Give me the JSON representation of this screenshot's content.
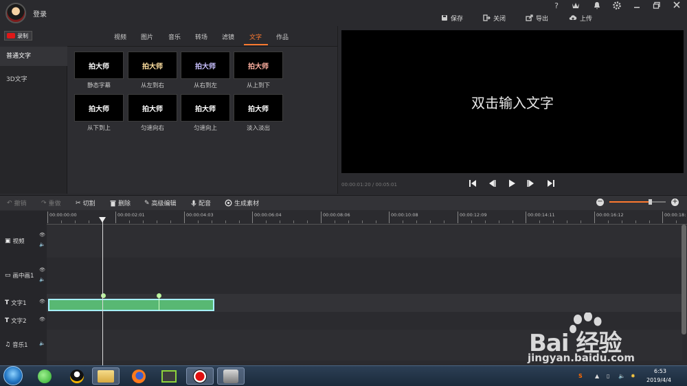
{
  "header": {
    "login_label": "登录",
    "icons": [
      "help-icon",
      "vip-icon",
      "notification-icon",
      "settings-icon",
      "minimize-icon",
      "restore-icon",
      "close-icon"
    ],
    "help_glyph": "?",
    "actions": [
      {
        "icon": "save-icon",
        "label": "保存"
      },
      {
        "icon": "close-project-icon",
        "label": "关闭"
      },
      {
        "icon": "export-icon",
        "label": "导出"
      },
      {
        "icon": "upload-icon",
        "label": "上传"
      }
    ]
  },
  "record_button": {
    "label": "录制"
  },
  "categories": [
    {
      "label": "普通文字",
      "active": true
    },
    {
      "label": "3D文字",
      "active": false
    }
  ],
  "tabs": [
    {
      "label": "视频",
      "active": false
    },
    {
      "label": "图片",
      "active": false
    },
    {
      "label": "音乐",
      "active": false
    },
    {
      "label": "转场",
      "active": false
    },
    {
      "label": "滤镜",
      "active": false
    },
    {
      "label": "文字",
      "active": true
    },
    {
      "label": "作品",
      "active": false
    }
  ],
  "text_templates": [
    {
      "preview": "拍大师",
      "label": "静态字幕",
      "color": "#ffffff"
    },
    {
      "preview": "拍大师",
      "label": "从左到右",
      "color": "#ffe0a0"
    },
    {
      "preview": "拍大师",
      "label": "从右到左",
      "color": "#c8c0ff"
    },
    {
      "preview": "拍大师",
      "label": "从上到下",
      "color": "#ffb0a0"
    },
    {
      "preview": "拍大师",
      "label": "从下到上",
      "color": "#ffffff"
    },
    {
      "preview": "拍大师",
      "label": "匀速向右",
      "color": "#ffffff"
    },
    {
      "preview": "拍大师",
      "label": "匀速向上",
      "color": "#ffffff"
    },
    {
      "preview": "拍大师",
      "label": "淡入淡出",
      "color": "#ffffff"
    }
  ],
  "preview": {
    "text": "双击输入文字",
    "timecode": "00:00:01:20 / 00:05:01"
  },
  "playback_icons": [
    "skip-to-start-icon",
    "previous-frame-icon",
    "play-icon",
    "next-frame-icon",
    "skip-to-end-icon"
  ],
  "toolbar": {
    "undo": "撤销",
    "redo": "重做",
    "cut": "切割",
    "delete": "删除",
    "advanced_edit": "高级编辑",
    "dub": "配音",
    "generate": "生成素材",
    "zoom_level": 0.72
  },
  "ruler_labels": [
    "00:00:00:00",
    "00:00:02:01",
    "00:00:04:03",
    "00:00:06:04",
    "00:00:08:06",
    "00:00:10:08",
    "00:00:12:09",
    "00:00:14:11",
    "00:00:16:12",
    "00:00:18:"
  ],
  "tracks": [
    {
      "label": "视频",
      "icon": "video-track-icon"
    },
    {
      "label": "画中画1",
      "icon": "pip-track-icon"
    },
    {
      "label": "文字1",
      "icon": "text-track-icon"
    },
    {
      "label": "文字2",
      "icon": "text-track-icon"
    },
    {
      "label": "音乐1",
      "icon": "music-track-icon"
    }
  ],
  "taskbar": {
    "time": "6:53",
    "date": "2019/4/4",
    "apps": [
      "start-orb-icon",
      "360-browser-icon",
      "qq-icon",
      "file-explorer-icon",
      "firefox-icon",
      "video-editor-icon",
      "recorder-icon",
      "paidashi-icon"
    ]
  },
  "watermark": {
    "brand": "Bai   经验",
    "url": "jingyan.baidu.com"
  }
}
